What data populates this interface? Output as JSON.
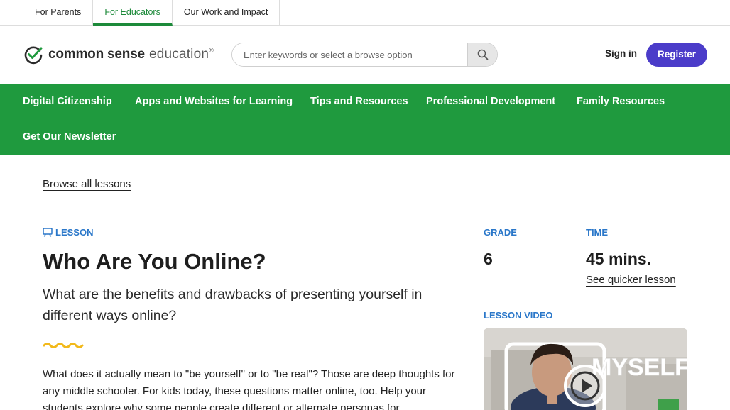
{
  "audience_tabs": [
    {
      "label": "For Parents"
    },
    {
      "label": "For Educators"
    },
    {
      "label": "Our Work and Impact"
    }
  ],
  "logo": {
    "bold": "common sense",
    "light": "education",
    "mark": "®"
  },
  "search": {
    "placeholder": "Enter keywords or select a browse option"
  },
  "auth": {
    "signin": "Sign in",
    "register": "Register"
  },
  "nav": [
    {
      "label": "Digital Citizenship"
    },
    {
      "label": "Apps and Websites for Learning"
    },
    {
      "label": "Tips and Resources"
    },
    {
      "label": "Professional Development"
    },
    {
      "label": "Family Resources"
    },
    {
      "label": "Get Our Newsletter"
    }
  ],
  "browse_link": "Browse all lessons",
  "lesson": {
    "tag": "LESSON",
    "title": "Who Are You Online?",
    "subtitle": "What are the benefits and drawbacks of presenting yourself in different ways online?",
    "description": "What does it actually mean to \"be yourself\" or to \"be real\"? Those are deep thoughts for any middle schooler. For kids today, these questions matter online, too. Help your students explore why some people create different or alternate personas for"
  },
  "meta": {
    "grade_label": "GRADE",
    "grade_value": "6",
    "time_label": "TIME",
    "time_value": "45 mins.",
    "quicker_link": "See quicker lesson",
    "video_label": "LESSON VIDEO"
  },
  "video": {
    "overlay_text": "MYSELF"
  },
  "colors": {
    "brand_green": "#1f9a3e",
    "accent_blue": "#2a77c9",
    "register_purple": "#4b3cc9",
    "squiggle_yellow": "#f2b91b"
  }
}
